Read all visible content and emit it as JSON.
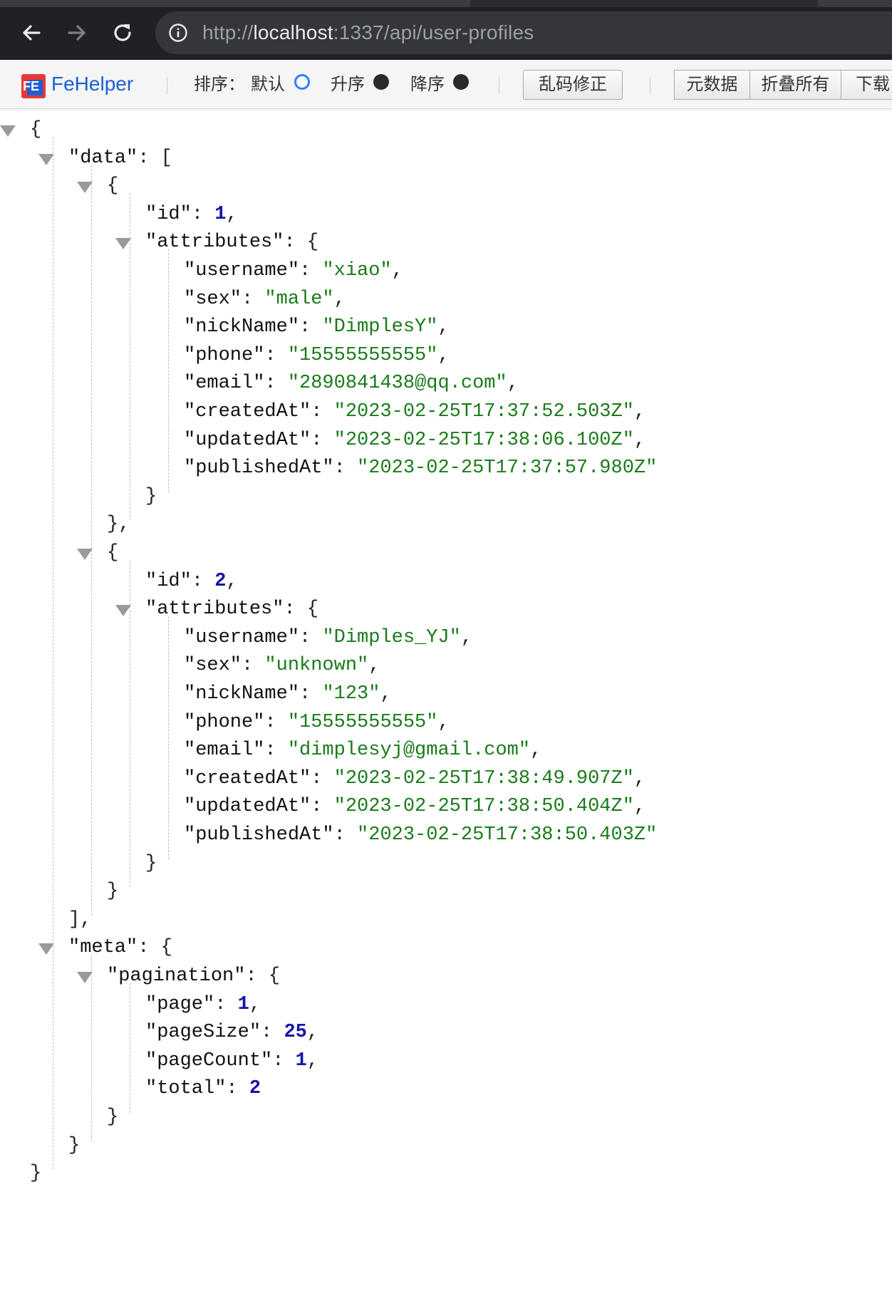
{
  "browser": {
    "url_scheme": "http://",
    "url_host": "localhost",
    "url_path": ":1337/api/user-profiles",
    "icons": [
      "back-arrow-icon",
      "forward-arrow-icon",
      "reload-icon",
      "info-icon"
    ]
  },
  "fehelper": {
    "title": "FeHelper",
    "logo_text": "FE",
    "sort_label": "排序：",
    "sort_default": "默认",
    "sort_asc": "升序",
    "sort_desc": "降序",
    "selected_sort": "默认",
    "fix_encoding": "乱码修正",
    "metadata": "元数据",
    "collapse_all": "折叠所有",
    "download": "下载",
    "colors": {
      "title": "#1a5fd1",
      "radio_on": "#2b82f6"
    }
  },
  "json": {
    "data": [
      {
        "id": 1,
        "attributes": {
          "username": "xiao",
          "sex": "male",
          "nickName": "DimplesY",
          "phone": "15555555555",
          "email": "2890841438@qq.com",
          "createdAt": "2023-02-25T17:37:52.503Z",
          "updatedAt": "2023-02-25T17:38:06.100Z",
          "publishedAt": "2023-02-25T17:37:57.980Z"
        }
      },
      {
        "id": 2,
        "attributes": {
          "username": "Dimples_YJ",
          "sex": "unknown",
          "nickName": "123",
          "phone": "15555555555",
          "email": "dimplesyj@gmail.com",
          "createdAt": "2023-02-25T17:38:49.907Z",
          "updatedAt": "2023-02-25T17:38:50.404Z",
          "publishedAt": "2023-02-25T17:38:50.403Z"
        }
      }
    ],
    "meta": {
      "pagination": {
        "page": 1,
        "pageSize": 25,
        "pageCount": 1,
        "total": 2
      }
    }
  },
  "colors": {
    "string": "#1a7a1a",
    "number": "#1515a8",
    "key": "#111111"
  }
}
